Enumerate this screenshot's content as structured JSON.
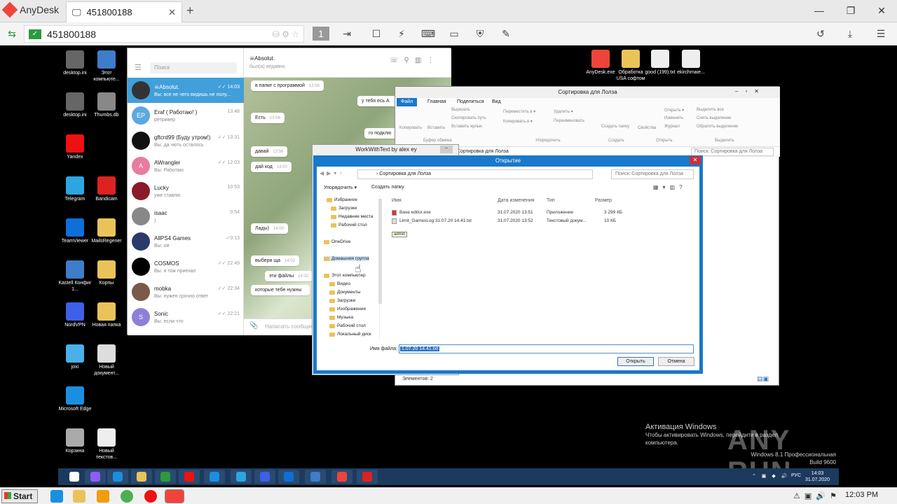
{
  "anydesk": {
    "app_name": "AnyDesk",
    "tab_label": "451800188",
    "tab_close": "✕",
    "new_tab": "+",
    "address": "451800188",
    "monitor_number": "1",
    "min": "—",
    "max": "❐",
    "close": "✕",
    "accent": "#ef443b"
  },
  "desktop": {
    "icons_left": [
      {
        "label": "desktop.ini",
        "color": "#666"
      },
      {
        "label": "Этот компьюте...",
        "color": "#3d7dc9"
      },
      {
        "label": "desktop.ini",
        "color": "#666"
      },
      {
        "label": "Thumbs.db",
        "color": "#888"
      },
      {
        "label": "Yandex",
        "color": "#e11"
      },
      {
        "label": "Telegram",
        "color": "#2ca5e0"
      },
      {
        "label": "Bandicam",
        "color": "#d22"
      },
      {
        "label": "TeamViewer",
        "color": "#0e6fd8"
      },
      {
        "label": "MailsRegener",
        "color": "#e9c35a"
      },
      {
        "label": "Kastell Конфиг 1...",
        "color": "#3d7dc9"
      },
      {
        "label": "Корпы",
        "color": "#e9c35a"
      },
      {
        "label": "NordVPN",
        "color": "#3e5fe8"
      },
      {
        "label": "Новая папка",
        "color": "#e9c35a"
      },
      {
        "label": "joxi",
        "color": "#4ab0e8"
      },
      {
        "label": "Новый документ...",
        "color": "#ddd"
      },
      {
        "label": "Microsoft Edge",
        "color": "#1a8fe0"
      },
      {
        "label": "Корзина",
        "color": "#aaa"
      },
      {
        "label": "Новый текстов...",
        "color": "#eee"
      }
    ],
    "icons_top": [
      {
        "label": "AnyDesk.exe",
        "color": "#ef443b"
      },
      {
        "label": "Обработка USA софтом",
        "color": "#e9c35a"
      },
      {
        "label": "good (199).txt",
        "color": "#eee"
      },
      {
        "label": "ekirchmaie...",
        "color": "#eee"
      }
    ]
  },
  "telegram": {
    "search_placeholder": "Поиск",
    "chats": [
      {
        "name": "☠Absolut.",
        "time": "✓✓ 14:03",
        "preview": "Вы: все не чего видишь не полу...",
        "avatar": "",
        "color": "#333",
        "selected": true
      },
      {
        "name": "Eraf ( Работаю! )",
        "time": "13:48",
        "preview": "ретривер",
        "avatar": "EP",
        "color": "#5da8e0",
        "selected": false
      },
      {
        "name": "gftcrd99 (Буду утром!)",
        "time": "✓✓ 13:31",
        "preview": "Вы: да чють осталось",
        "avatar": "",
        "color": "#111",
        "selected": false
      },
      {
        "name": "AWrangler",
        "time": "✓✓ 12:03",
        "preview": "Вы: Работаю",
        "avatar": "A",
        "color": "#e87b9e",
        "selected": false
      },
      {
        "name": "Lucky",
        "time": "10:53",
        "preview": "уже ставлю",
        "avatar": "",
        "color": "#8a1a2a",
        "selected": false
      },
      {
        "name": "isaac",
        "time": "0:54",
        "preview": ")",
        "avatar": "",
        "color": "#888",
        "selected": false
      },
      {
        "name": "AllPS4 Games",
        "time": "✓0:13",
        "preview": "Вы: ой",
        "avatar": "",
        "color": "#2b3a6b",
        "selected": false
      },
      {
        "name": "COSMOS",
        "time": "✓✓ 22:49",
        "preview": "Вы: я тож приехал",
        "avatar": "",
        "color": "#000",
        "selected": false
      },
      {
        "name": "mobka",
        "time": "✓✓ 22:34",
        "preview": "Вы: нужен срочно ответ",
        "avatar": "",
        "color": "#7a5a4a",
        "selected": false
      },
      {
        "name": "Sonic",
        "time": "✓✓ 22:21",
        "preview": "Вы: если что",
        "avatar": "S",
        "color": "#8e7fd8",
        "selected": false
      }
    ],
    "header_name": "☠Absolut.",
    "header_status": "был(а) недавно",
    "messages": [
      {
        "text": "в папке с программой",
        "time": "13:56"
      },
      {
        "text": "у тебя есь А",
        "time": ""
      },
      {
        "text": "Есть",
        "time": "13:56"
      },
      {
        "text": "го подклю",
        "time": ""
      },
      {
        "text": "давай",
        "time": "13:56"
      },
      {
        "text": "дай код",
        "time": "14:00"
      },
      {
        "text": "Лады)",
        "time": "14:00"
      },
      {
        "text": "выбери ща",
        "time": "14:02"
      },
      {
        "text": "эти файлы",
        "time": "14:02"
      },
      {
        "text": "которые тебе нужны",
        "time": ""
      }
    ],
    "input_placeholder": "Написать сообщение..."
  },
  "explorer": {
    "title": "Сортировка для Лолза",
    "tabs": [
      "Файл",
      "Главная",
      "Поделиться",
      "Вид"
    ],
    "ribbon": [
      "Копировать",
      "Вставить",
      "Вырезать",
      "Скопировать путь",
      "Вставить ярлык",
      "Переместить в ▾",
      "Копировать в ▾",
      "Удалить ▾",
      "Переименовать",
      "Создать папку",
      "Свойства",
      "Открыть ▾",
      "Изменить",
      "Журнал",
      "Выделить все",
      "Снять выделение",
      "Обратить выделение"
    ],
    "groups": [
      "Буфер обмена",
      "Упорядочить",
      "Создать",
      "Открыть",
      "Выделить"
    ],
    "address": "Сортировка для Лолза",
    "search": "Поиск: Сортировка для Лолза",
    "status": "Элементов: 2"
  },
  "wwt": {
    "title": "WorkWithText by alex ey"
  },
  "dialog": {
    "title": "Открытие",
    "close": "✕",
    "address": "› Сортировка для Лолза",
    "search": "Поиск: Сортировка для Лолза",
    "organize": "Упорядочить ▾",
    "new_folder": "Создать папку",
    "tree": [
      "Избранное",
      "Загрузки",
      "Недавние места",
      "Рабочий стол",
      "OneDrive",
      "Домашняя группа",
      "Этот компьютер",
      "Видео",
      "Документы",
      "Загрузки",
      "Изображения",
      "Музыка",
      "Рабочий стол",
      "Локальный диск"
    ],
    "tooltip": "admin",
    "columns": [
      "Имя",
      "Дата изменения",
      "Тип",
      "Размер"
    ],
    "files": [
      {
        "name": "Base editor.exe",
        "date": "31.07.2020 13:51",
        "type": "Приложение",
        "size": "3 299 КБ"
      },
      {
        "name": "Limit_GamesLog 31.07.20 14.41.txt",
        "date": "31.07.2020 13:52",
        "type": "Текстовый докум...",
        "size": "10 КБ"
      }
    ],
    "filename_label": "Имя файла:",
    "filename_value": "1.07.20 14.41.txt",
    "open": "Открыть",
    "cancel": "Отмена"
  },
  "remote_taskbar": {
    "apps": [
      "#fff",
      "#8e5cf7",
      "#1a8fe0",
      "#e9c35a",
      "#2b9a3e",
      "#e11",
      "#1a8fe0",
      "#2ca5e0",
      "#3e5fe8",
      "#0e6fd8",
      "#3d7dc9",
      "#ef443b",
      "#d22"
    ],
    "lang": "РУС",
    "time": "14:03",
    "date": "31.07.2020"
  },
  "activation": {
    "title": "Активация Windows",
    "line1": "Чтобы активировать Windows, перейдите в раздел",
    "line2": "компьютера."
  },
  "winver": {
    "line1": "Windows 8.1 Профессиональная",
    "line2": "Build 9600"
  },
  "watermark": "ANY RUN",
  "host_taskbar": {
    "start": "Start",
    "time": "12:03 PM"
  }
}
